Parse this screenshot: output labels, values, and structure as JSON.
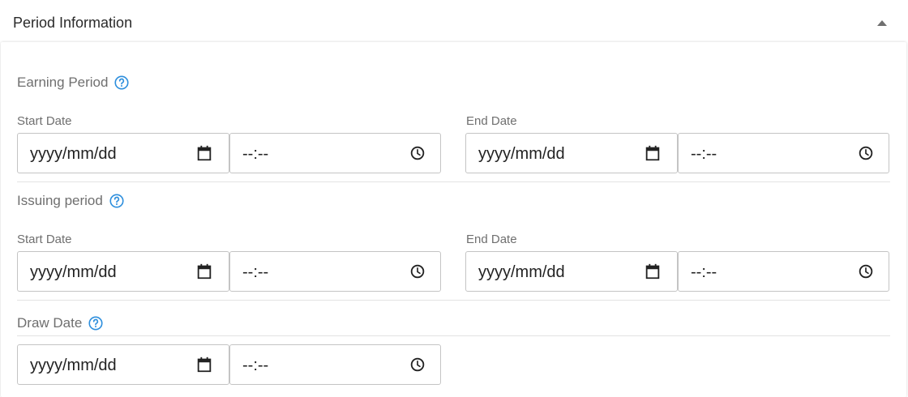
{
  "panel": {
    "title": "Period Information",
    "collapse_icon": "chevron-up-icon"
  },
  "sections": {
    "earning": {
      "title": "Earning Period",
      "start_label": "Start Date",
      "end_label": "End Date",
      "start_date_placeholder": "yyyy/mm/dd",
      "start_time_placeholder": "--:--",
      "end_date_placeholder": "yyyy/mm/dd",
      "end_time_placeholder": "--:--"
    },
    "issuing": {
      "title": "Issuing period",
      "start_label": "Start Date",
      "end_label": "End Date",
      "start_date_placeholder": "yyyy/mm/dd",
      "start_time_placeholder": "--:--",
      "end_date_placeholder": "yyyy/mm/dd",
      "end_time_placeholder": "--:--"
    },
    "draw": {
      "title": "Draw Date",
      "date_placeholder": "yyyy/mm/dd",
      "time_placeholder": "--:--"
    }
  },
  "icons": {
    "help": "help-circle-icon",
    "calendar": "calendar-icon",
    "clock": "clock-icon"
  },
  "colors": {
    "accent": "#2e8fdd",
    "label": "#6f6f6f",
    "border": "#c4c4c4",
    "text": "#222222"
  }
}
